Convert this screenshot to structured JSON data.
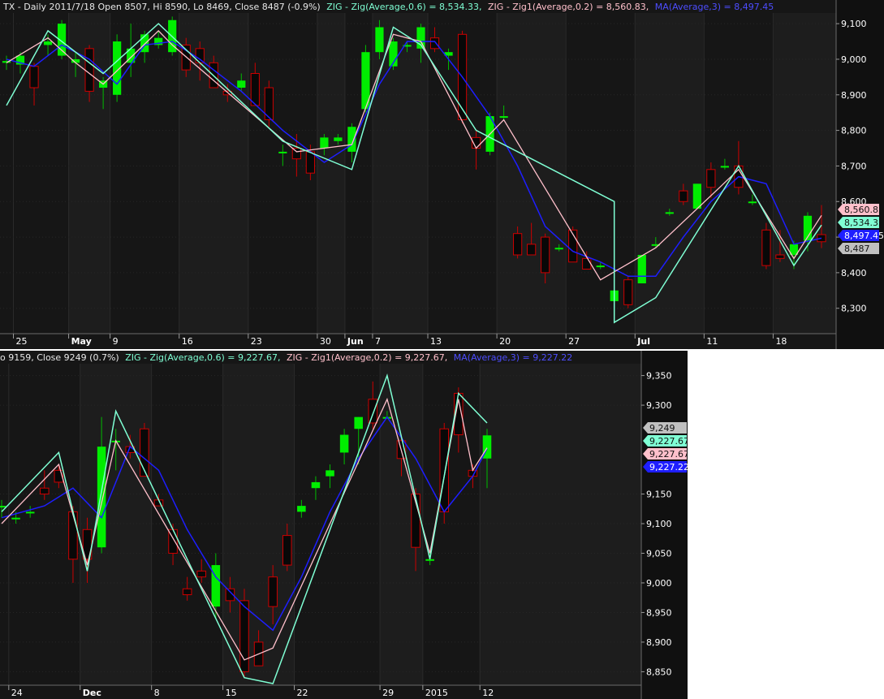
{
  "top": {
    "header": {
      "prefix": "TX - Daily 2011/7/18 Open 8507, Hi 8590, Lo 8469, Close 8487 (-0.9%)",
      "zig": "ZIG - Zig(Average,0.6) = 8,534.33,",
      "zig1": "ZIG - Zig1(Average,0.2) = 8,560.83,",
      "ma": "MA(Average,3) = 8,497.45"
    },
    "colors": {
      "zig": "#7fffd4",
      "zig1": "#ffc0cb",
      "ma": "#1e1eff",
      "up": "#00ee00",
      "down": "#cc0000"
    }
  },
  "bottom": {
    "header": {
      "prefix": "o 9159, Close 9249 (0.7%)",
      "zig": "ZIG - Zig(Average,0.6) = 9,227.67,",
      "zig1": "ZIG - Zig1(Average,0.2) = 9,227.67,",
      "ma": "MA(Average,3) = 9,227.22"
    }
  },
  "chart_data": [
    {
      "type": "candlestick",
      "ylim": [
        8240,
        9130
      ],
      "yticks": [
        {
          "v": 8300,
          "label": "8,300"
        },
        {
          "v": 8400,
          "label": "8,400"
        },
        {
          "v": 8500,
          "label": "8,500"
        },
        {
          "v": 8600,
          "label": "8,600"
        },
        {
          "v": 8700,
          "label": "8,700"
        },
        {
          "v": 8800,
          "label": "8,800"
        },
        {
          "v": 8900,
          "label": "8,900"
        },
        {
          "v": 9000,
          "label": "9,000"
        },
        {
          "v": 9100,
          "label": "9,100"
        }
      ],
      "xticks": [
        {
          "i": 1,
          "label": "25"
        },
        {
          "i": 5,
          "label": "May"
        },
        {
          "i": 8,
          "label": "9"
        },
        {
          "i": 13,
          "label": "16"
        },
        {
          "i": 18,
          "label": "23"
        },
        {
          "i": 23,
          "label": "30"
        },
        {
          "i": 25,
          "label": "Jun"
        },
        {
          "i": 27,
          "label": "7"
        },
        {
          "i": 31,
          "label": "13"
        },
        {
          "i": 36,
          "label": "20"
        },
        {
          "i": 41,
          "label": "27"
        },
        {
          "i": 46,
          "label": "Jul"
        },
        {
          "i": 51,
          "label": "11"
        },
        {
          "i": 56,
          "label": "18"
        }
      ],
      "value_tags": [
        {
          "v": 8560.83,
          "label": "8,560.83",
          "bg": "#ffc0cb"
        },
        {
          "v": 8534.33,
          "label": "8,534.33",
          "bg": "#7fffd4"
        },
        {
          "v": 8497.45,
          "label": "8,497.45",
          "bg": "#1e1eff",
          "fg": "#ffffff"
        },
        {
          "v": 8487,
          "label": "8,487",
          "bg": "#c0c0c0"
        }
      ],
      "candles": [
        [
          8990,
          9010,
          8970,
          8995
        ],
        [
          8985,
          9020,
          8960,
          9010
        ],
        [
          8980,
          8990,
          8870,
          8920
        ],
        [
          9040,
          9070,
          9010,
          9050
        ],
        [
          9010,
          9110,
          9000,
          9100
        ],
        [
          8990,
          9020,
          8950,
          9000
        ],
        [
          9030,
          9040,
          8880,
          8910
        ],
        [
          8920,
          8950,
          8860,
          8940
        ],
        [
          8900,
          9070,
          8880,
          9050
        ],
        [
          8990,
          9100,
          8950,
          9030
        ],
        [
          9020,
          9080,
          8990,
          9070
        ],
        [
          9040,
          9080,
          9030,
          9060
        ],
        [
          9020,
          9120,
          9010,
          9110
        ],
        [
          9040,
          9060,
          8950,
          8970
        ],
        [
          9030,
          9050,
          8940,
          8990
        ],
        [
          8990,
          9010,
          8920,
          8920
        ],
        [
          8910,
          8930,
          8880,
          8900
        ],
        [
          8920,
          8960,
          8910,
          8940
        ],
        [
          8960,
          8990,
          8870,
          8870
        ],
        [
          8920,
          8940,
          8810,
          8830
        ],
        [
          8740,
          8760,
          8700,
          8740
        ],
        [
          8750,
          8790,
          8670,
          8720
        ],
        [
          8740,
          8760,
          8660,
          8680
        ],
        [
          8750,
          8790,
          8730,
          8780
        ],
        [
          8770,
          8790,
          8760,
          8780
        ],
        [
          8740,
          8820,
          8710,
          8810
        ],
        [
          8860,
          9040,
          8850,
          9020
        ],
        [
          9020,
          9110,
          9000,
          9090
        ],
        [
          8980,
          9060,
          8970,
          9050
        ],
        [
          9040,
          9050,
          9020,
          9040
        ],
        [
          9030,
          9100,
          8990,
          9090
        ],
        [
          9060,
          9090,
          9020,
          9030
        ],
        [
          9010,
          9030,
          8970,
          9020
        ],
        [
          9070,
          9080,
          8820,
          8830
        ],
        [
          8780,
          8800,
          8690,
          8750
        ],
        [
          8740,
          8850,
          8730,
          8840
        ],
        [
          8840,
          8870,
          8830,
          8840
        ],
        [
          8510,
          8530,
          8440,
          8450
        ],
        [
          8480,
          8540,
          8450,
          8450
        ],
        [
          8500,
          8510,
          8370,
          8400
        ],
        [
          8470,
          8480,
          8460,
          8470
        ],
        [
          8520,
          8530,
          8430,
          8430
        ],
        [
          8440,
          8460,
          8410,
          8410
        ],
        [
          8420,
          8430,
          8410,
          8420
        ],
        [
          8320,
          8350,
          8280,
          8350
        ],
        [
          8380,
          8390,
          8300,
          8310
        ],
        [
          8370,
          8450,
          8370,
          8450
        ],
        [
          8480,
          8500,
          8470,
          8480
        ],
        [
          8570,
          8580,
          8560,
          8570
        ],
        [
          8630,
          8650,
          8590,
          8600
        ],
        [
          8580,
          8650,
          8580,
          8650
        ],
        [
          8690,
          8710,
          8610,
          8640
        ],
        [
          8700,
          8720,
          8690,
          8700
        ],
        [
          8700,
          8770,
          8620,
          8640
        ],
        [
          8600,
          8620,
          8590,
          8600
        ],
        [
          8520,
          8540,
          8410,
          8420
        ],
        [
          8450,
          8520,
          8430,
          8440
        ],
        [
          8450,
          8490,
          8410,
          8480
        ],
        [
          8490,
          8570,
          8460,
          8560
        ],
        [
          8507,
          8590,
          8469,
          8487
        ]
      ],
      "zig": [
        [
          0,
          8870
        ],
        [
          3,
          9080
        ],
        [
          7,
          8960
        ],
        [
          11,
          9100
        ],
        [
          20,
          8770
        ],
        [
          25,
          8690
        ],
        [
          28,
          9090
        ],
        [
          30,
          9040
        ],
        [
          34,
          8800
        ],
        [
          44,
          8600
        ],
        [
          44,
          8260
        ],
        [
          47,
          8330
        ],
        [
          53,
          8700
        ],
        [
          57,
          8420
        ],
        [
          59,
          8534
        ]
      ],
      "zig1": [
        [
          0,
          8990
        ],
        [
          3,
          9060
        ],
        [
          5,
          8990
        ],
        [
          7,
          8930
        ],
        [
          11,
          9080
        ],
        [
          12,
          9040
        ],
        [
          21,
          8740
        ],
        [
          25,
          8760
        ],
        [
          28,
          9070
        ],
        [
          30,
          9050
        ],
        [
          34,
          8750
        ],
        [
          36,
          8830
        ],
        [
          43,
          8380
        ],
        [
          47,
          8470
        ],
        [
          53,
          8690
        ],
        [
          57,
          8440
        ],
        [
          59,
          8561
        ]
      ],
      "ma": [
        [
          0,
          9000
        ],
        [
          2,
          8980
        ],
        [
          4,
          9040
        ],
        [
          6,
          9000
        ],
        [
          8,
          8930
        ],
        [
          10,
          9040
        ],
        [
          12,
          9050
        ],
        [
          14,
          9000
        ],
        [
          17,
          8910
        ],
        [
          20,
          8800
        ],
        [
          23,
          8710
        ],
        [
          25,
          8760
        ],
        [
          27,
          8930
        ],
        [
          29,
          9050
        ],
        [
          31,
          9050
        ],
        [
          33,
          8950
        ],
        [
          35,
          8840
        ],
        [
          37,
          8700
        ],
        [
          39,
          8530
        ],
        [
          41,
          8460
        ],
        [
          43,
          8430
        ],
        [
          45,
          8390
        ],
        [
          47,
          8390
        ],
        [
          49,
          8500
        ],
        [
          51,
          8600
        ],
        [
          53,
          8670
        ],
        [
          55,
          8650
        ],
        [
          57,
          8480
        ],
        [
          59,
          8497
        ]
      ]
    },
    {
      "type": "candlestick",
      "ylim": [
        8830,
        9370
      ],
      "yticks": [
        {
          "v": 8850,
          "label": "8,850"
        },
        {
          "v": 8900,
          "label": "8,900"
        },
        {
          "v": 8950,
          "label": "8,950"
        },
        {
          "v": 9000,
          "label": "9,000"
        },
        {
          "v": 9050,
          "label": "9,050"
        },
        {
          "v": 9100,
          "label": "9,100"
        },
        {
          "v": 9150,
          "label": "9,150"
        },
        {
          "v": 9300,
          "label": "9,300"
        },
        {
          "v": 9350,
          "label": "9,350"
        }
      ],
      "xticks": [
        {
          "i": 1,
          "label": "24"
        },
        {
          "i": 6,
          "label": "Dec"
        },
        {
          "i": 11,
          "label": "8"
        },
        {
          "i": 16,
          "label": "15"
        },
        {
          "i": 21,
          "label": "22"
        },
        {
          "i": 27,
          "label": "29"
        },
        {
          "i": 30,
          "label": "2015"
        },
        {
          "i": 34,
          "label": "12"
        }
      ],
      "value_tags": [
        {
          "v": 9249,
          "label": "9,249",
          "bg": "#c0c0c0"
        },
        {
          "v": 9227.67,
          "label": "9,227.67",
          "bg": "#7fffd4"
        },
        {
          "v": 9227.67,
          "label": "9,227.67",
          "bg": "#ffc0cb"
        },
        {
          "v": 9227.22,
          "label": "9,227.22",
          "bg": "#1e1eff",
          "fg": "#ffffff"
        }
      ],
      "candles": [
        [
          9130,
          9140,
          9110,
          9130
        ],
        [
          9110,
          9120,
          9100,
          9110
        ],
        [
          9120,
          9130,
          9110,
          9120
        ],
        [
          9160,
          9190,
          9140,
          9150
        ],
        [
          9190,
          9200,
          9160,
          9170
        ],
        [
          9120,
          9130,
          9000,
          9040
        ],
        [
          9090,
          9110,
          9000,
          9040
        ],
        [
          9060,
          9280,
          9050,
          9230
        ],
        [
          9240,
          9260,
          9190,
          9240
        ],
        [
          9230,
          9250,
          9210,
          9220
        ],
        [
          9260,
          9270,
          9180,
          9180
        ],
        [
          9140,
          9150,
          9130,
          9130
        ],
        [
          9090,
          9100,
          9030,
          9050
        ],
        [
          8990,
          9010,
          8970,
          8980
        ],
        [
          9020,
          9040,
          9000,
          9010
        ],
        [
          8960,
          9050,
          8940,
          9030
        ],
        [
          8990,
          9010,
          8950,
          8970
        ],
        [
          8970,
          8990,
          8840,
          8850
        ],
        [
          8900,
          8920,
          8860,
          8860
        ],
        [
          9010,
          9030,
          8930,
          8960
        ],
        [
          9080,
          9100,
          9020,
          9030
        ],
        [
          9120,
          9140,
          9110,
          9130
        ],
        [
          9160,
          9180,
          9140,
          9170
        ],
        [
          9180,
          9200,
          9160,
          9190
        ],
        [
          9220,
          9260,
          9200,
          9250
        ],
        [
          9260,
          9280,
          9200,
          9280
        ],
        [
          9310,
          9340,
          9260,
          9270
        ],
        [
          9280,
          9290,
          9280,
          9280
        ],
        [
          9240,
          9250,
          9180,
          9210
        ],
        [
          9150,
          9160,
          9020,
          9060
        ],
        [
          9040,
          9050,
          9030,
          9040
        ],
        [
          9260,
          9270,
          9100,
          9120
        ],
        [
          9320,
          9330,
          9220,
          9250
        ],
        [
          9190,
          9200,
          9160,
          9180
        ],
        [
          9210,
          9260,
          9160,
          9249
        ]
      ],
      "zig": [
        [
          0,
          9120
        ],
        [
          4,
          9220
        ],
        [
          6,
          9020
        ],
        [
          8,
          9290
        ],
        [
          17,
          8840
        ],
        [
          19,
          8830
        ],
        [
          27,
          9350
        ],
        [
          30,
          9040
        ],
        [
          32,
          9320
        ],
        [
          34,
          9270
        ]
      ],
      "zig1": [
        [
          0,
          9100
        ],
        [
          4,
          9200
        ],
        [
          6,
          9030
        ],
        [
          8,
          9240
        ],
        [
          17,
          8870
        ],
        [
          19,
          8890
        ],
        [
          27,
          9310
        ],
        [
          30,
          9050
        ],
        [
          32,
          9310
        ],
        [
          33,
          9190
        ],
        [
          34,
          9228
        ]
      ],
      "ma": [
        [
          0,
          9110
        ],
        [
          3,
          9130
        ],
        [
          5,
          9160
        ],
        [
          7,
          9110
        ],
        [
          9,
          9230
        ],
        [
          11,
          9190
        ],
        [
          13,
          9090
        ],
        [
          15,
          9010
        ],
        [
          17,
          8960
        ],
        [
          19,
          8920
        ],
        [
          21,
          9010
        ],
        [
          23,
          9120
        ],
        [
          25,
          9210
        ],
        [
          27,
          9280
        ],
        [
          29,
          9210
        ],
        [
          31,
          9120
        ],
        [
          33,
          9180
        ],
        [
          34,
          9227
        ]
      ]
    }
  ]
}
